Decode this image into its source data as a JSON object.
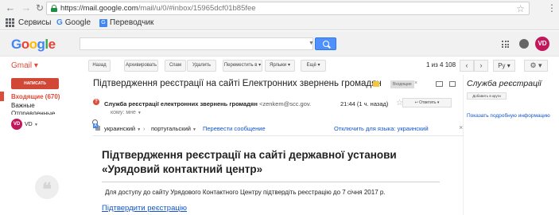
{
  "browser": {
    "url_host": "https://mail.google.com",
    "url_path": "/mail/u/0/#inbox/15965dcf01b85fee",
    "bookmarks": {
      "apps": "Сервисы",
      "google": "Google",
      "translate": "Переводчик"
    }
  },
  "header": {
    "logo": "Google",
    "avatar_initials": "VD"
  },
  "toolbar": {
    "gmail_label": "Gmail",
    "back": "Назад",
    "archive": "Архивировать",
    "spam": "Спам",
    "delete": "Удалить",
    "move_to": "Переместить в",
    "labels": "Ярлыки",
    "more": "Ещё",
    "page_count": "1 из 4 108",
    "input_lang": "Ру"
  },
  "sidebar": {
    "compose": "НАПИСАТЬ",
    "inbox": "Входящие (670)",
    "starred": "Важные",
    "important": "Отправленные",
    "hangouts_user": "VD"
  },
  "message": {
    "subject": "Підтвердження реєстрації на сайті Електронних звернень громадян",
    "folder_chip": "Входящие",
    "sender_name": "Служба реєстрації електронних звернень громадян",
    "sender_email": "<zenkem@scc.gov.",
    "time": "21:44 (1 ч. назад)",
    "reply_label": "Ответить",
    "to_line": "кому: мне",
    "translate": {
      "from_lang": "украинский",
      "arrow": "›",
      "to_lang": "португальский",
      "translate_link": "Перевести сообщение",
      "disable_link": "Отключить для языка: украинский"
    },
    "body": {
      "heading": "Підтвердження реєстрації на сайті державної установи «Урядовий контактний центр»",
      "text": "Для доступу до сайту Урядового Контактного Центру підтвердіть реєстрацію до 7 січня 2017 р.",
      "confirm_link": "Підтвердити реєстрацію"
    }
  },
  "right_panel": {
    "name": "Служба реєстрації",
    "add_to_circles": "Добавить в круги",
    "details_link": "Показать подробную информацию"
  },
  "colors": {
    "avatar": "#c2185b",
    "inbox_red": "#dd4b39",
    "search_blue": "#4d90fe",
    "link_blue": "#1155cc",
    "compose_red": "#d14836"
  }
}
